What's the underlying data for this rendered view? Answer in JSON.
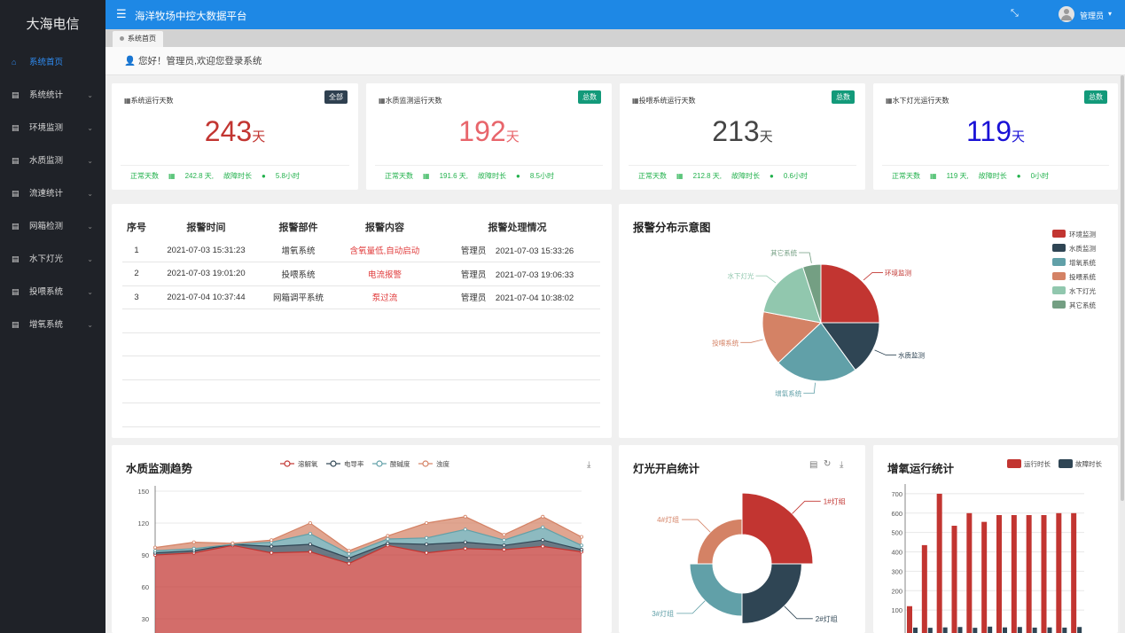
{
  "sidebar": {
    "logo": "大海电信",
    "items": [
      {
        "label": "系统首页"
      },
      {
        "label": "系统统计"
      },
      {
        "label": "环境监测"
      },
      {
        "label": "水质监测"
      },
      {
        "label": "流速统计"
      },
      {
        "label": "网箱检测"
      },
      {
        "label": "水下灯光"
      },
      {
        "label": "投喂系统"
      },
      {
        "label": "增氧系统"
      }
    ]
  },
  "header": {
    "title": "海洋牧场中控大数据平台",
    "user": "管理员"
  },
  "tabs": [
    {
      "label": "系统首页"
    }
  ],
  "welcome": "您好！管理员,欢迎您登录系统",
  "stats": [
    {
      "title": "系统运行天数",
      "badge": "全部",
      "badge_color": "#2f4050",
      "value": "243",
      "unit": "天",
      "value_color": "#c23531",
      "normal_label": "正常天数",
      "normal_value": "242.8 天,",
      "fault_label": "故障时长",
      "fault_value": "5.8小时"
    },
    {
      "title": "水质监测运行天数",
      "badge": "总数",
      "badge_color": "#139a7a",
      "value": "192",
      "unit": "天",
      "value_color": "#e8656b",
      "normal_label": "正常天数",
      "normal_value": "191.6 天,",
      "fault_label": "故障时长",
      "fault_value": "8.5小时"
    },
    {
      "title": "投喂系统运行天数",
      "badge": "总数",
      "badge_color": "#139a7a",
      "value": "213",
      "unit": "天",
      "value_color": "#444444",
      "normal_label": "正常天数",
      "normal_value": "212.8 天,",
      "fault_label": "故障时长",
      "fault_value": "0.6小时"
    },
    {
      "title": "水下灯光运行天数",
      "badge": "总数",
      "badge_color": "#139a7a",
      "value": "119",
      "unit": "天",
      "value_color": "#1a12d6",
      "normal_label": "正常天数",
      "normal_value": "119 天,",
      "fault_label": "故障时长",
      "fault_value": "0小时"
    }
  ],
  "alarm_table": {
    "headers": [
      "序号",
      "报警时间",
      "报警部件",
      "报警内容",
      "报警处理情况"
    ],
    "rows": [
      {
        "no": "1",
        "time": "2021-07-03 15:31:23",
        "part": "增氧系统",
        "content": "含氧量低,自动启动",
        "handler": "管理员",
        "handled_time": "2021-07-03 15:33:26"
      },
      {
        "no": "2",
        "time": "2021-07-03 19:01:20",
        "part": "投喂系统",
        "content": "电流报警",
        "handler": "管理员",
        "handled_time": "2021-07-03 19:06:33"
      },
      {
        "no": "3",
        "time": "2021-07-04 10:37:44",
        "part": "网箱调平系统",
        "content": "泵过流",
        "handler": "管理员",
        "handled_time": "2021-07-04 10:38:02"
      }
    ]
  },
  "chart_data": [
    {
      "type": "pie",
      "title": "报警分布示意图",
      "categories": [
        "环境监测",
        "水质监测",
        "增氧系统",
        "投喂系统",
        "水下灯光",
        "其它系统"
      ],
      "values": [
        25,
        15,
        23,
        15,
        17,
        5
      ],
      "colors": [
        "#c23531",
        "#2f4554",
        "#61a0a8",
        "#d48265",
        "#91c7ae",
        "#749f83"
      ],
      "legend": "top-right"
    },
    {
      "type": "area",
      "title": "水质监测趋势",
      "series": [
        {
          "name": "溶解氧",
          "values": [
            90,
            92,
            99,
            92,
            93,
            82,
            99,
            92,
            96,
            95,
            98,
            93
          ],
          "color": "#c23531"
        },
        {
          "name": "电导率",
          "values": [
            2,
            2,
            1,
            6,
            7,
            5,
            2,
            8,
            6,
            4,
            6,
            2
          ],
          "color": "#2f4554"
        },
        {
          "name": "酸碱度",
          "values": [
            2,
            2,
            0,
            4,
            10,
            4,
            4,
            6,
            12,
            5,
            12,
            4
          ],
          "color": "#61a0a8"
        },
        {
          "name": "浊度",
          "values": [
            3,
            6,
            1,
            2,
            10,
            3,
            3,
            14,
            12,
            5,
            10,
            8
          ],
          "color": "#d48265"
        }
      ],
      "yticks": [
        30,
        60,
        90,
        120,
        150
      ],
      "ylim": [
        0,
        150
      ],
      "legend": "top"
    },
    {
      "type": "pie",
      "title": "灯光开启统计",
      "categories": [
        "1#灯组",
        "2#灯组",
        "3#灯组",
        "4#灯组"
      ],
      "values": [
        100,
        70,
        50,
        30
      ],
      "colors": [
        "#c23531",
        "#2f4554",
        "#61a0a8",
        "#d48265"
      ]
    },
    {
      "type": "bar",
      "title": "增氧运行统计",
      "series": [
        {
          "name": "运行时长",
          "values": [
            120,
            435,
            700,
            535,
            600,
            555,
            590,
            590,
            590,
            590,
            600,
            600
          ],
          "color": "#c23531"
        },
        {
          "name": "故障时长",
          "values": [
            5,
            4,
            6,
            8,
            4,
            10,
            6,
            8,
            5,
            6,
            5,
            8
          ],
          "color": "#2f4554"
        }
      ],
      "yticks": [
        100,
        200,
        300,
        400,
        500,
        600,
        700
      ],
      "ylim": [
        0,
        750
      ],
      "legend": "top-right"
    }
  ]
}
